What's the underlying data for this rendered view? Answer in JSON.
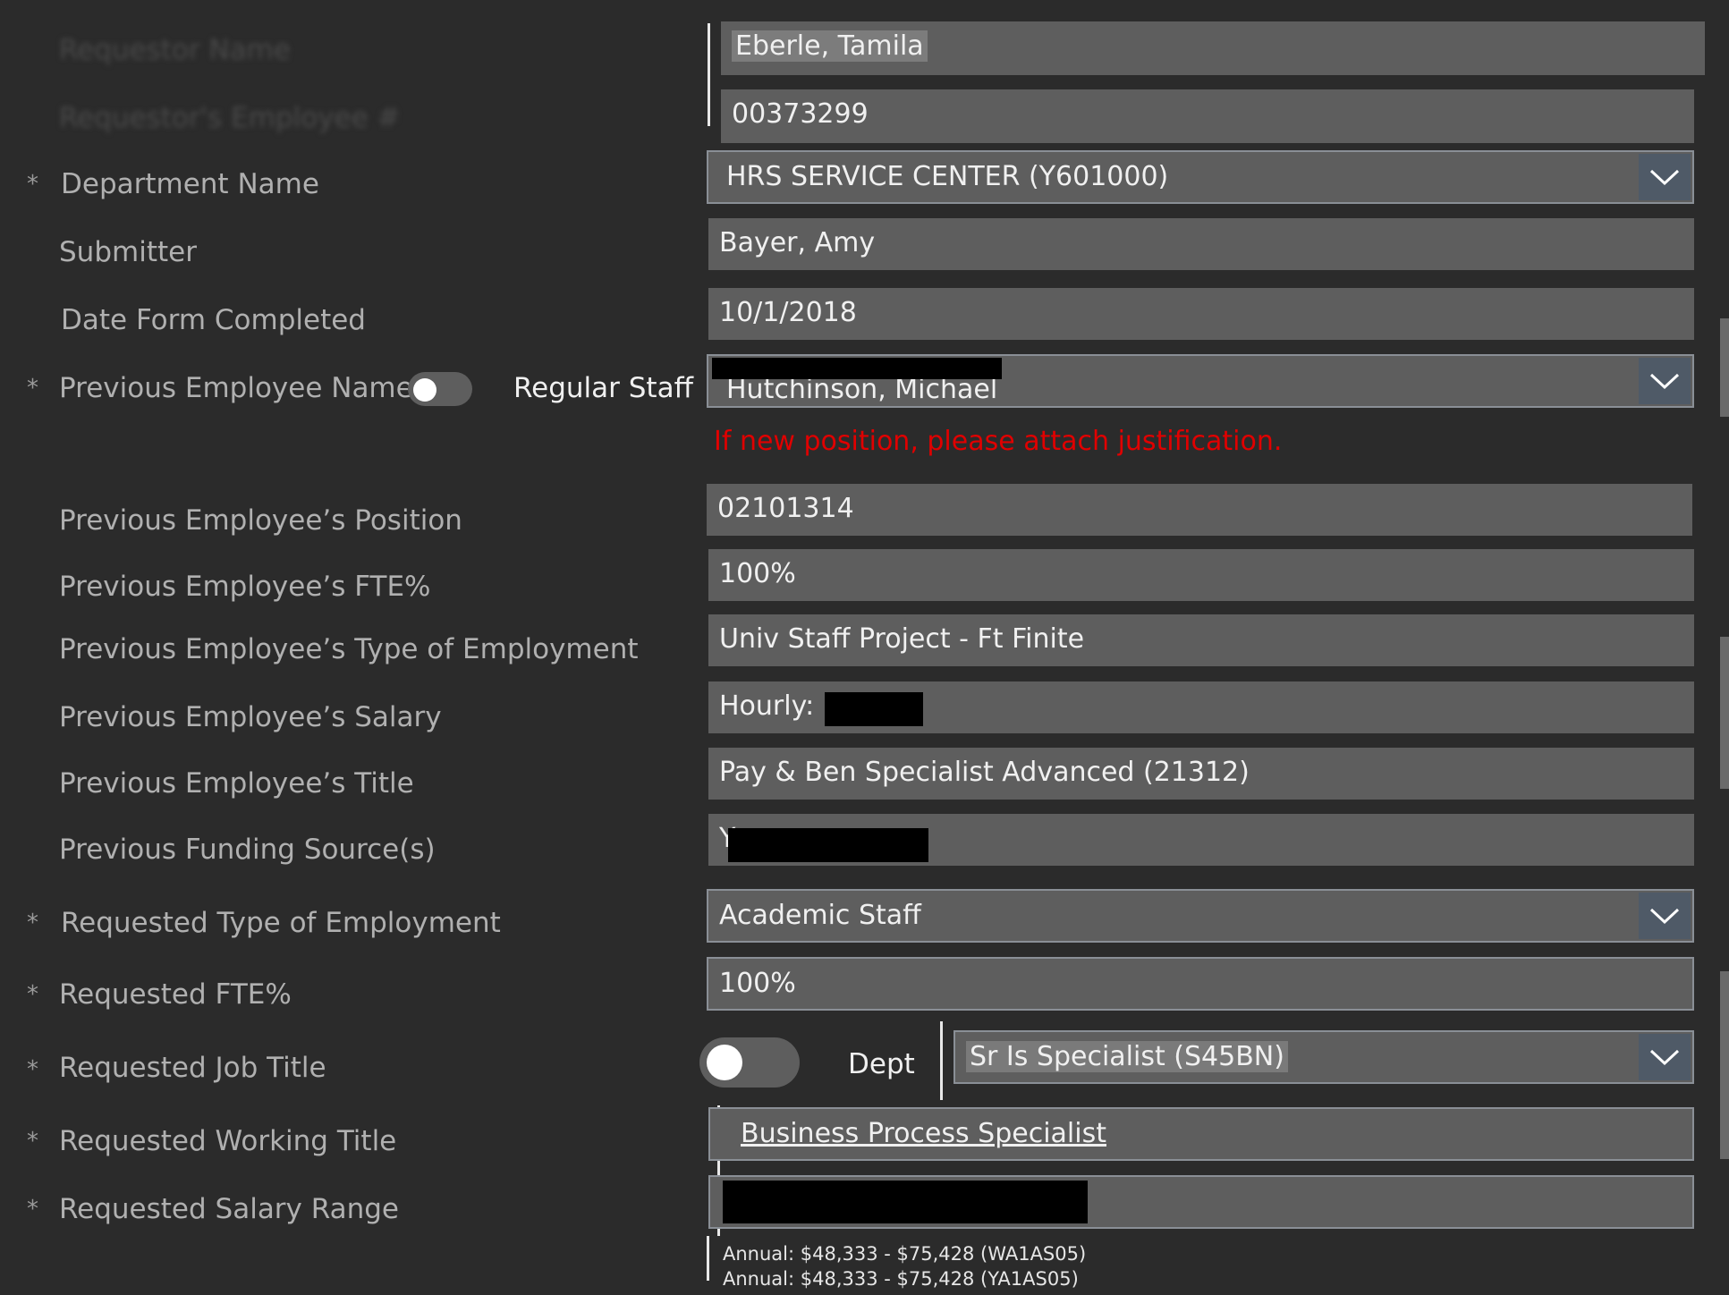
{
  "form": {
    "requestor_name": {
      "label": "Requestor Name",
      "value": "Eberle, Tamila"
    },
    "requestor_employee_id": {
      "label": "Requestor's Employee #",
      "value": "00373299"
    },
    "department_name": {
      "label": "Department Name",
      "value": "HRS SERVICE CENTER (Y601000)",
      "required": true
    },
    "submitter": {
      "label": "Submitter",
      "value": "Bayer, Amy"
    },
    "date_form_completed": {
      "label": "Date Form Completed",
      "value": "10/1/2018"
    },
    "previous_employee_name": {
      "label": "Previous Employee Name",
      "toggle_label": "Regular Staff",
      "value": "Hutchinson, Michael",
      "required": true
    },
    "justification_note": "If new position, please attach justification.",
    "previous_position": {
      "label": "Previous Employee’s Position",
      "value": "02101314"
    },
    "previous_fte": {
      "label": "Previous Employee’s FTE%",
      "value": "100%"
    },
    "previous_type": {
      "label": "Previous Employee’s Type of Employment",
      "value": "Univ Staff Project - Ft Finite"
    },
    "previous_salary": {
      "label": "Previous Employee’s Salary",
      "value": "Hourly: $"
    },
    "previous_title": {
      "label": "Previous Employee’s Title",
      "value": "Pay & Ben Specialist Advanced (21312)"
    },
    "previous_funding": {
      "label": "Previous Funding Source(s)",
      "value": "Y"
    },
    "requested_type": {
      "label": "Requested Type of Employment",
      "value": "Academic Staff",
      "required": true
    },
    "requested_fte": {
      "label": "Requested FTE%",
      "value": "100%",
      "required": true
    },
    "requested_job_title": {
      "label": "Requested Job Title",
      "toggle_label": "Dept",
      "value": "Sr Is Specialist (S45BN)",
      "required": true
    },
    "requested_working_title": {
      "label": "Requested Working Title",
      "value": "Business Process Specialist",
      "required": true
    },
    "requested_salary_range": {
      "label": "Requested Salary Range",
      "required": true,
      "ranges": [
        "Annual: $48,333 - $75,428    (WA1AS05)",
        "Annual: $48,333 - $75,428    (YA1AS05)"
      ]
    }
  },
  "required_marker": "*",
  "icons": {
    "dropdown": "chevron-down-icon"
  }
}
